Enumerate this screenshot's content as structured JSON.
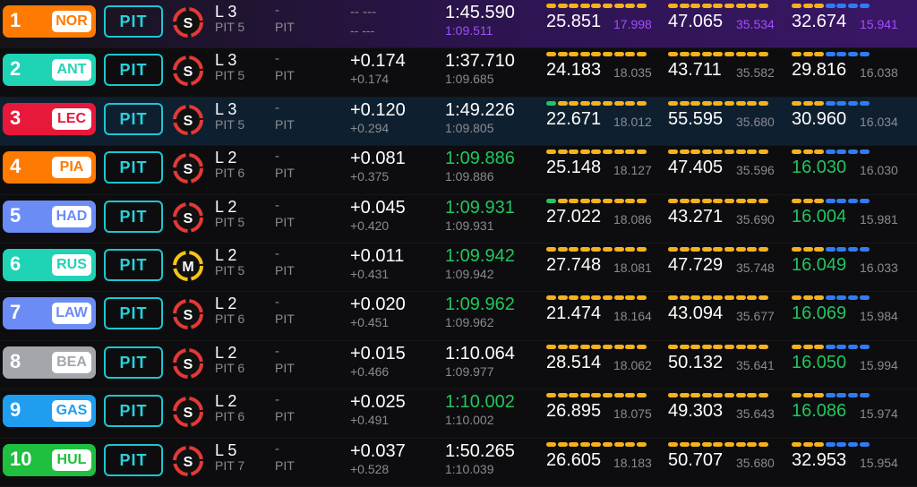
{
  "colors": {
    "pit_border": "#1cc7d1",
    "green": "#22c55e",
    "purple": "#a24dff",
    "seg_yellow": "#f5b21b",
    "seg_blue": "#2f7cf6",
    "seg_green": "#22c55e",
    "seg_purple": "#8b3dff",
    "soft": "#e53935",
    "medium": "#f5c518"
  },
  "pit_label": "PIT",
  "rows": [
    {
      "pos": "1",
      "code": "NOR",
      "team_color": "#ff7a00",
      "tyre": "S",
      "tyre_name": "soft-tyre-icon",
      "lap": "L 3",
      "pits": "PIT 5",
      "dash1": "-",
      "dash2": "PIT",
      "interval": "-- ---",
      "gap": "-- ---",
      "last": "1:45.590",
      "best": "1:09.511",
      "best_color": "purple",
      "s1": "25.851",
      "s1b": "17.998",
      "s1b_color": "purple",
      "s2": "47.065",
      "s2b": "35.534",
      "s2b_color": "purple",
      "s3": "32.674",
      "s3b": "15.941",
      "s3b_color": "purple",
      "bars1": "yyyyyyyyy",
      "bars2": "yyyyyyyyy",
      "bars3": "yyybbbb",
      "row_style": "purple"
    },
    {
      "pos": "2",
      "code": "ANT",
      "team_color": "#1fd3b5",
      "tyre": "S",
      "tyre_name": "soft-tyre-icon",
      "lap": "L 3",
      "pits": "PIT 5",
      "dash1": "-",
      "dash2": "PIT",
      "interval": "+0.174",
      "gap": "+0.174",
      "last": "1:37.710",
      "best": "1:09.685",
      "best_color": "grey",
      "s1": "24.183",
      "s1b": "18.035",
      "s1b_color": "grey",
      "s2": "43.711",
      "s2b": "35.582",
      "s2b_color": "grey",
      "s3": "29.816",
      "s3b": "16.038",
      "s3b_color": "grey",
      "bars1": "yyyyyyyyy",
      "bars2": "yyyyyyyyy",
      "bars3": "yyybbbb",
      "row_style": ""
    },
    {
      "pos": "3",
      "code": "LEC",
      "team_color": "#e8183a",
      "tyre": "S",
      "tyre_name": "soft-tyre-icon",
      "lap": "L 3",
      "pits": "PIT 5",
      "dash1": "-",
      "dash2": "PIT",
      "interval": "+0.120",
      "gap": "+0.294",
      "last": "1:49.226",
      "best": "1:09.805",
      "best_color": "grey",
      "s1": "22.671",
      "s1b": "18.012",
      "s1b_color": "grey",
      "s2": "55.595",
      "s2b": "35.680",
      "s2b_color": "grey",
      "s3": "30.960",
      "s3b": "16.034",
      "s3b_color": "grey",
      "bars1": "gyyyyyyyy",
      "bars2": "yyyyyyyyy",
      "bars3": "yyybbbb",
      "row_style": "selected"
    },
    {
      "pos": "4",
      "code": "PIA",
      "team_color": "#ff7a00",
      "tyre": "S",
      "tyre_name": "soft-tyre-icon",
      "lap": "L 2",
      "pits": "PIT 6",
      "dash1": "-",
      "dash2": "PIT",
      "interval": "+0.081",
      "gap": "+0.375",
      "last": "1:09.886",
      "last_color": "green",
      "best": "1:09.886",
      "best_color": "grey",
      "s1": "25.148",
      "s1b": "18.127",
      "s1b_color": "grey",
      "s2": "47.405",
      "s2b": "35.596",
      "s2b_color": "grey",
      "s3": "16.030",
      "s3_color": "green",
      "s3b": "16.030",
      "s3b_color": "grey",
      "bars1": "yyyyyyyyy",
      "bars2": "yyyyyyyyy",
      "bars3": "yyybbbb",
      "row_style": ""
    },
    {
      "pos": "5",
      "code": "HAD",
      "team_color": "#6c8cf5",
      "tyre": "S",
      "tyre_name": "soft-tyre-icon",
      "lap": "L 2",
      "pits": "PIT 5",
      "dash1": "-",
      "dash2": "PIT",
      "interval": "+0.045",
      "gap": "+0.420",
      "last": "1:09.931",
      "last_color": "green",
      "best": "1:09.931",
      "best_color": "grey",
      "s1": "27.022",
      "s1b": "18.086",
      "s1b_color": "grey",
      "s2": "43.271",
      "s2b": "35.690",
      "s2b_color": "grey",
      "s3": "16.004",
      "s3_color": "green",
      "s3b": "15.981",
      "s3b_color": "grey",
      "bars1": "gyyyyyyyy",
      "bars2": "yyyyyyyyy",
      "bars3": "yyybbbb",
      "row_style": ""
    },
    {
      "pos": "6",
      "code": "RUS",
      "team_color": "#1fd3b5",
      "tyre": "M",
      "tyre_name": "medium-tyre-icon",
      "lap": "L 2",
      "pits": "PIT 5",
      "dash1": "-",
      "dash2": "PIT",
      "interval": "+0.011",
      "gap": "+0.431",
      "last": "1:09.942",
      "last_color": "green",
      "best": "1:09.942",
      "best_color": "grey",
      "s1": "27.748",
      "s1b": "18.081",
      "s1b_color": "grey",
      "s2": "47.729",
      "s2b": "35.748",
      "s2b_color": "grey",
      "s3": "16.049",
      "s3_color": "green",
      "s3b": "16.033",
      "s3b_color": "grey",
      "bars1": "yyyyyyyyy",
      "bars2": "yyyyyyyyy",
      "bars3": "yyybbbb",
      "row_style": ""
    },
    {
      "pos": "7",
      "code": "LAW",
      "team_color": "#6c8cf5",
      "tyre": "S",
      "tyre_name": "soft-tyre-icon",
      "lap": "L 2",
      "pits": "PIT 6",
      "dash1": "-",
      "dash2": "PIT",
      "interval": "+0.020",
      "gap": "+0.451",
      "last": "1:09.962",
      "last_color": "green",
      "best": "1:09.962",
      "best_color": "grey",
      "s1": "21.474",
      "s1b": "18.164",
      "s1b_color": "grey",
      "s2": "43.094",
      "s2b": "35.677",
      "s2b_color": "grey",
      "s3": "16.069",
      "s3_color": "green",
      "s3b": "15.984",
      "s3b_color": "grey",
      "bars1": "yyyyyyyyy",
      "bars2": "yyyyyyyyy",
      "bars3": "yyybbbb",
      "row_style": ""
    },
    {
      "pos": "8",
      "code": "BEA",
      "team_color": "#a3a6ab",
      "tyre": "S",
      "tyre_name": "soft-tyre-icon",
      "lap": "L 2",
      "pits": "PIT 6",
      "dash1": "-",
      "dash2": "PIT",
      "interval": "+0.015",
      "gap": "+0.466",
      "last": "1:10.064",
      "best": "1:09.977",
      "best_color": "grey",
      "s1": "28.514",
      "s1b": "18.062",
      "s1b_color": "grey",
      "s2": "50.132",
      "s2b": "35.641",
      "s2b_color": "grey",
      "s3": "16.050",
      "s3_color": "green",
      "s3b": "15.994",
      "s3b_color": "grey",
      "bars1": "yyyyyyyyy",
      "bars2": "yyyyyyyyy",
      "bars3": "yyybbbb",
      "row_style": ""
    },
    {
      "pos": "9",
      "code": "GAS",
      "team_color": "#1f9ef0",
      "tyre": "S",
      "tyre_name": "soft-tyre-icon",
      "lap": "L 2",
      "pits": "PIT 6",
      "dash1": "-",
      "dash2": "PIT",
      "interval": "+0.025",
      "gap": "+0.491",
      "last": "1:10.002",
      "last_color": "green",
      "best": "1:10.002",
      "best_color": "grey",
      "s1": "26.895",
      "s1b": "18.075",
      "s1b_color": "grey",
      "s2": "49.303",
      "s2b": "35.643",
      "s2b_color": "grey",
      "s3": "16.086",
      "s3_color": "green",
      "s3b": "15.974",
      "s3b_color": "grey",
      "bars1": "yyyyyyyyy",
      "bars2": "yyyyyyyyy",
      "bars3": "yyybbbb",
      "row_style": ""
    },
    {
      "pos": "10",
      "code": "HUL",
      "team_color": "#1fbf3f",
      "tyre": "S",
      "tyre_name": "soft-tyre-icon",
      "lap": "L 5",
      "pits": "PIT 7",
      "dash1": "-",
      "dash2": "PIT",
      "interval": "+0.037",
      "gap": "+0.528",
      "last": "1:50.265",
      "best": "1:10.039",
      "best_color": "grey",
      "s1": "26.605",
      "s1b": "18.183",
      "s1b_color": "grey",
      "s2": "50.707",
      "s2b": "35.680",
      "s2b_color": "grey",
      "s3": "32.953",
      "s3b": "15.954",
      "s3b_color": "grey",
      "bars1": "yyyyyyyyy",
      "bars2": "yyyyyyyyy",
      "bars3": "yyybbbb",
      "row_style": ""
    }
  ]
}
